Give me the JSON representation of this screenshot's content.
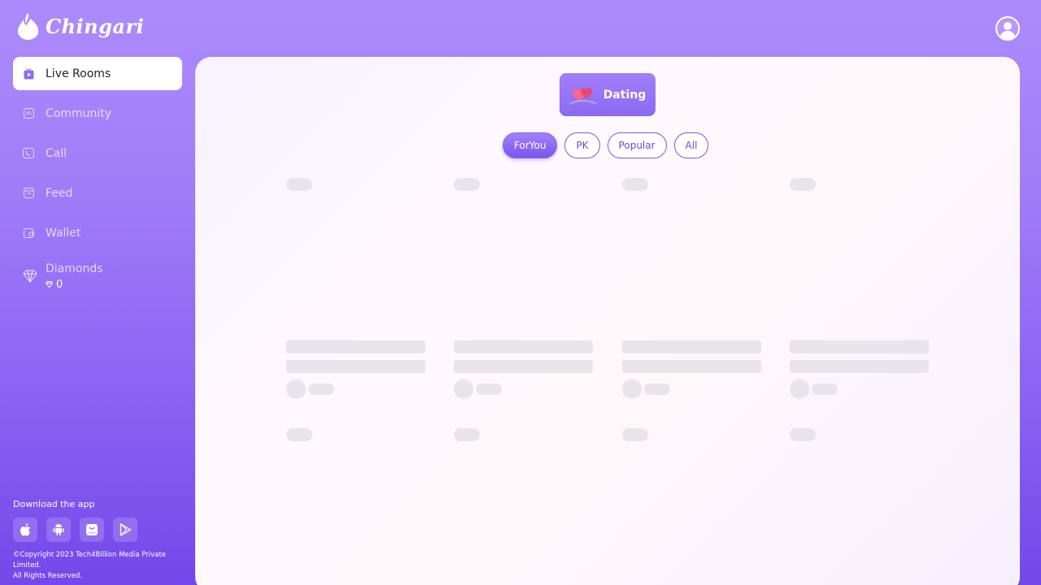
{
  "app": {
    "logo_text": "Chingari"
  },
  "sidebar": {
    "items": [
      {
        "label": "Live Rooms",
        "icon": "live-tv-icon",
        "active": true
      },
      {
        "label": "Community",
        "icon": "community-icon"
      },
      {
        "label": "Call",
        "icon": "video-call-icon"
      },
      {
        "label": "Feed",
        "icon": "feed-icon"
      },
      {
        "label": "Wallet",
        "icon": "wallet-icon"
      },
      {
        "label": "Diamonds",
        "icon": "diamond-icon",
        "count": "0"
      }
    ]
  },
  "download": {
    "title": "Download the app",
    "stores": [
      "apple-icon",
      "android-icon",
      "huawei-appgallery-icon",
      "google-play-icon"
    ],
    "copyright_line1": "©Copyright 2023 Tech4Billion Media Private Limited.",
    "copyright_line2": "All Rights Reserved."
  },
  "main": {
    "category_label": "Dating",
    "tabs": [
      {
        "label": "ForYou",
        "active": true
      },
      {
        "label": "PK"
      },
      {
        "label": "Popular"
      },
      {
        "label": "All"
      }
    ]
  },
  "colors": {
    "accent": "#7d56ee",
    "sidebar_gradient_top": "#ad8bfb",
    "sidebar_gradient_bottom": "#7447ea",
    "skeleton": "#e7e5e9"
  }
}
